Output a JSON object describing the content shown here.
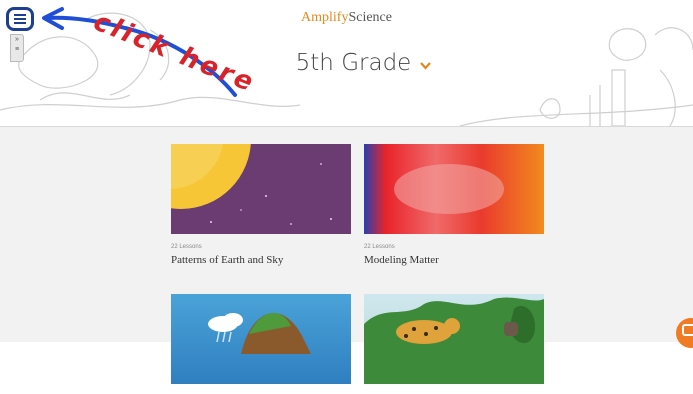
{
  "header": {
    "brand_part1": "Amplify",
    "brand_part2": "Science",
    "grade_title": "5th Grade"
  },
  "annotation": {
    "text": "click here",
    "color": "#1f4fd6"
  },
  "units": [
    {
      "lessons": "22 Lessons",
      "title": "Patterns of Earth and Sky"
    },
    {
      "lessons": "22 Lessons",
      "title": "Modeling Matter"
    },
    {
      "lessons": "",
      "title": ""
    },
    {
      "lessons": "",
      "title": ""
    }
  ],
  "colors": {
    "accent": "#e08a1e",
    "menu_button": "#1c3f8f",
    "chat_button": "#f07b22",
    "content_bg": "#f2f2f2"
  },
  "icons": {
    "menu": "hamburger-menu-icon",
    "dropdown": "chevron-down-icon",
    "side_tab": "expand-arrows-icon",
    "chat": "chat-bubble-icon"
  }
}
